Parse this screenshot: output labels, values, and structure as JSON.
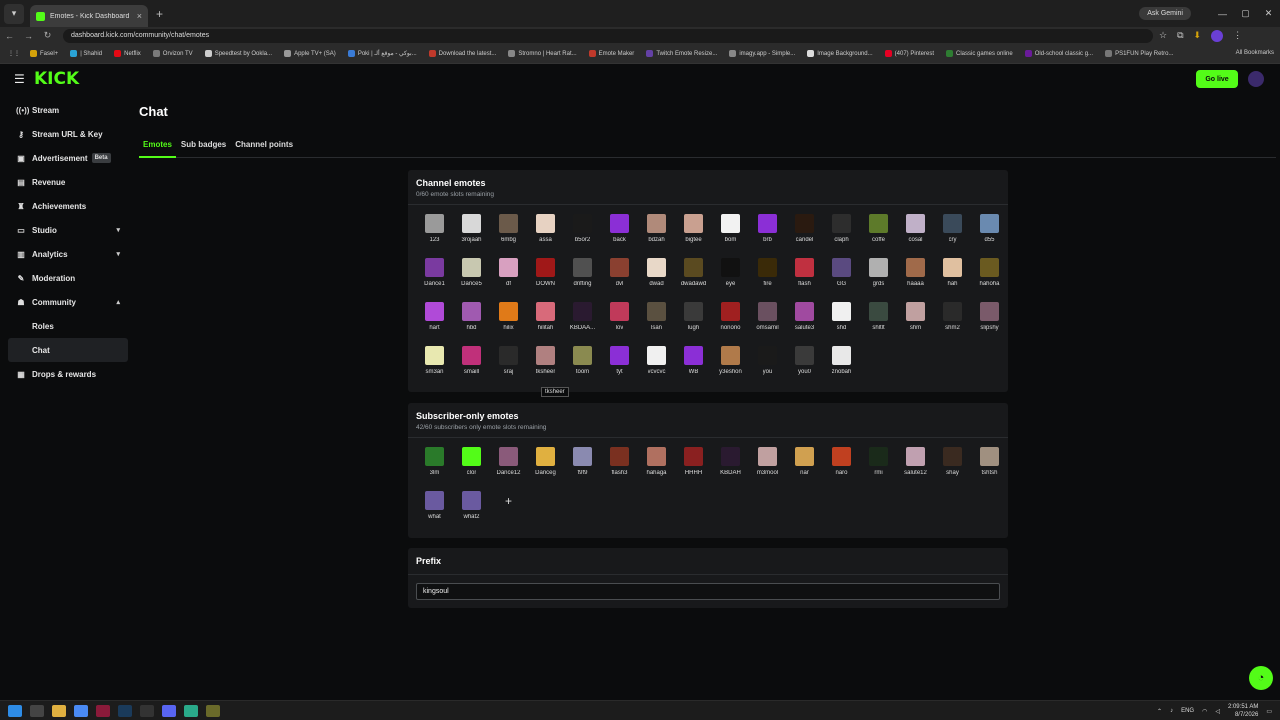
{
  "browser": {
    "tab_title": "Emotes - Kick Dashboard",
    "tab_close": "×",
    "new_tab": "+",
    "ask_gemini": "Ask Gemini",
    "url": "dashboard.kick.com/community/chat/emotes",
    "bookmarks": [
      {
        "label": "Fasel+",
        "color": "#d4a20a"
      },
      {
        "label": "| Shahid",
        "color": "#2aa3d6"
      },
      {
        "label": "Netflix",
        "color": "#e50914"
      },
      {
        "label": "Orvizon TV",
        "color": "#7a7a7a"
      },
      {
        "label": "Speedtest by Ookla...",
        "color": "#cccccc"
      },
      {
        "label": "Apple TV+ (SA)",
        "color": "#999999"
      },
      {
        "label": "Poki | بوكي - موقع ألـ...",
        "color": "#3a7bd5"
      },
      {
        "label": "Download the latest...",
        "color": "#c0392b"
      },
      {
        "label": "Stromno | Heart Rat...",
        "color": "#888888"
      },
      {
        "label": "Emote Maker",
        "color": "#c0392b"
      },
      {
        "label": "Twitch Emote Resize...",
        "color": "#6441a5"
      },
      {
        "label": "imagy.app - Simple...",
        "color": "#888888"
      },
      {
        "label": "Image Background...",
        "color": "#dddddd"
      },
      {
        "label": "(407) Pinterest",
        "color": "#e60023"
      },
      {
        "label": "Classic games online",
        "color": "#2e7d32"
      },
      {
        "label": "Old-school classic g...",
        "color": "#6a1b9a"
      },
      {
        "label": "PS1FUN Play Retro...",
        "color": "#777777"
      }
    ],
    "all_bookmarks": "All Bookmarks"
  },
  "header": {
    "logo": "KICK",
    "go_live": "Go live"
  },
  "sidebar": {
    "items": [
      {
        "label": "Stream",
        "icon": "stream-icon",
        "glyph": "((•))"
      },
      {
        "label": "Stream URL & Key",
        "icon": "key-icon",
        "glyph": "⚷"
      },
      {
        "label": "Advertisement",
        "icon": "ad-icon",
        "glyph": "▣",
        "badge": "Beta"
      },
      {
        "label": "Revenue",
        "icon": "revenue-icon",
        "glyph": "▤"
      },
      {
        "label": "Achievements",
        "icon": "trophy-icon",
        "glyph": "♜"
      },
      {
        "label": "Studio",
        "icon": "studio-icon",
        "glyph": "▭",
        "chevron": "▾"
      },
      {
        "label": "Analytics",
        "icon": "chart-icon",
        "glyph": "▥",
        "chevron": "▾"
      },
      {
        "label": "Moderation",
        "icon": "wrench-icon",
        "glyph": "✎"
      },
      {
        "label": "Community",
        "icon": "community-icon",
        "glyph": "☗",
        "chevron": "▴"
      },
      {
        "label": "Roles",
        "sub": true
      },
      {
        "label": "Chat",
        "sub": true,
        "active": true
      },
      {
        "label": "Drops & rewards",
        "icon": "gift-icon",
        "glyph": "▦"
      }
    ]
  },
  "page": {
    "title": "Chat",
    "tabs": [
      "Emotes",
      "Sub badges",
      "Channel points"
    ],
    "active_tab": "Emotes"
  },
  "channel_emotes": {
    "title": "Channel emotes",
    "subtitle": "0/60 emote slots remaining",
    "emotes": [
      {
        "name": "123",
        "color": "#9a9a9a"
      },
      {
        "name": "3rojaah",
        "color": "#d8d8d8"
      },
      {
        "name": "6mbg",
        "color": "#6b5a4a"
      },
      {
        "name": "assa",
        "color": "#e7d2c2"
      },
      {
        "name": "b5or2",
        "color": "#1a1a1a"
      },
      {
        "name": "back",
        "color": "#8b2fd6"
      },
      {
        "name": "bdzah",
        "color": "#b08a7a"
      },
      {
        "name": "bigtee",
        "color": "#c9a090"
      },
      {
        "name": "bom",
        "color": "#f2f2f2"
      },
      {
        "name": "brb",
        "color": "#8b2fd6"
      },
      {
        "name": "candel",
        "color": "#2a1a10"
      },
      {
        "name": "claph",
        "color": "#2d2d2d"
      },
      {
        "name": "coffe",
        "color": "#5d7a2a"
      },
      {
        "name": "cosal",
        "color": "#c0b0c8"
      },
      {
        "name": "cry",
        "color": "#3a4a5a"
      },
      {
        "name": "d55",
        "color": "#6a8ab0"
      },
      {
        "name": "Dance1",
        "color": "#7a3aa0"
      },
      {
        "name": "Dance5",
        "color": "#c8c8b0"
      },
      {
        "name": "df",
        "color": "#d8a0c0"
      },
      {
        "name": "DOWN",
        "color": "#a01818"
      },
      {
        "name": "drifting",
        "color": "#505050"
      },
      {
        "name": "dvl",
        "color": "#8a4030"
      },
      {
        "name": "dwad",
        "color": "#e8d8c8"
      },
      {
        "name": "dwadawd",
        "color": "#5a4a20"
      },
      {
        "name": "eye",
        "color": "#111111"
      },
      {
        "name": "fire",
        "color": "#3a2a08"
      },
      {
        "name": "flash",
        "color": "#c03040"
      },
      {
        "name": "GG",
        "color": "#5a4a80"
      },
      {
        "name": "grds",
        "color": "#b0b0b0"
      },
      {
        "name": "haaaa",
        "color": "#a06a4a"
      },
      {
        "name": "hah",
        "color": "#e0c0a0"
      },
      {
        "name": "hahoha",
        "color": "#6a5a20"
      },
      {
        "name": "hart",
        "color": "#b04ad8"
      },
      {
        "name": "hbd",
        "color": "#a05ab0"
      },
      {
        "name": "hilix",
        "color": "#e07a18"
      },
      {
        "name": "hilitah",
        "color": "#d86a7a"
      },
      {
        "name": "KBDAA...",
        "color": "#2a1a30"
      },
      {
        "name": "lov",
        "color": "#c03a5a"
      },
      {
        "name": "lsan",
        "color": "#5a5040"
      },
      {
        "name": "lugh",
        "color": "#3a3a3a"
      },
      {
        "name": "nonono",
        "color": "#a02020"
      },
      {
        "name": "omsamil",
        "color": "#6a5060"
      },
      {
        "name": "salute3",
        "color": "#a04aa0"
      },
      {
        "name": "shd",
        "color": "#f0f0f0"
      },
      {
        "name": "shltlt",
        "color": "#3a4a40"
      },
      {
        "name": "shm",
        "color": "#c0a0a0"
      },
      {
        "name": "shm2",
        "color": "#2a2a2a"
      },
      {
        "name": "slipshy",
        "color": "#7a5a6a"
      },
      {
        "name": "sm3an",
        "color": "#e8e8b0"
      },
      {
        "name": "smaill",
        "color": "#c0307a"
      },
      {
        "name": "sraj",
        "color": "#2a2a2a"
      },
      {
        "name": "tksheer",
        "color": "#b08080"
      },
      {
        "name": "toom",
        "color": "#8a8a50"
      },
      {
        "name": "tyt",
        "color": "#8b2fd6"
      },
      {
        "name": "vcvcvc",
        "color": "#f0f0f0"
      },
      {
        "name": "WB",
        "color": "#8b2fd6"
      },
      {
        "name": "y3eshon",
        "color": "#b07a4a"
      },
      {
        "name": "you",
        "color": "#1a1a1a"
      },
      {
        "name": "you0",
        "color": "#3a3a3a"
      },
      {
        "name": "znobah",
        "color": "#e8e8e8"
      }
    ],
    "tooltip": "tksheer"
  },
  "subscriber_emotes": {
    "title": "Subscriber-only emotes",
    "subtitle": "42/60 subscribers only emote slots remaining",
    "emotes": [
      {
        "name": "3lm",
        "color": "#2a7a2a"
      },
      {
        "name": "clor",
        "color": "#53fc18"
      },
      {
        "name": "Dance12",
        "color": "#8a5a7a"
      },
      {
        "name": "Danceg",
        "color": "#e0b040"
      },
      {
        "name": "f9f9",
        "color": "#8a8ab0"
      },
      {
        "name": "flash3",
        "color": "#7a3020"
      },
      {
        "name": "hahaga",
        "color": "#b07060"
      },
      {
        "name": "HHHH",
        "color": "#8a2020"
      },
      {
        "name": "KBDAH",
        "color": "#2a1a30"
      },
      {
        "name": "m3mool",
        "color": "#c0a0a0"
      },
      {
        "name": "nar",
        "color": "#d0a050"
      },
      {
        "name": "naro",
        "color": "#c04020"
      },
      {
        "name": "rmi",
        "color": "#1a2a1a"
      },
      {
        "name": "salute12",
        "color": "#c0a0b0"
      },
      {
        "name": "shay",
        "color": "#3a2a20"
      },
      {
        "name": "tshtsh",
        "color": "#a09080"
      },
      {
        "name": "what",
        "color": "#6a5aa0"
      },
      {
        "name": "what2",
        "color": "#6a5aa0"
      }
    ],
    "add_label": "+"
  },
  "prefix": {
    "title": "Prefix",
    "value": "kingsoul"
  },
  "taskbar": {
    "time": "2:09:51 AM",
    "date": "8/7/2026",
    "lang": "ENG"
  },
  "colors": {
    "accent": "#53fc18",
    "background": "#0b0c0d",
    "card": "#18191b"
  }
}
